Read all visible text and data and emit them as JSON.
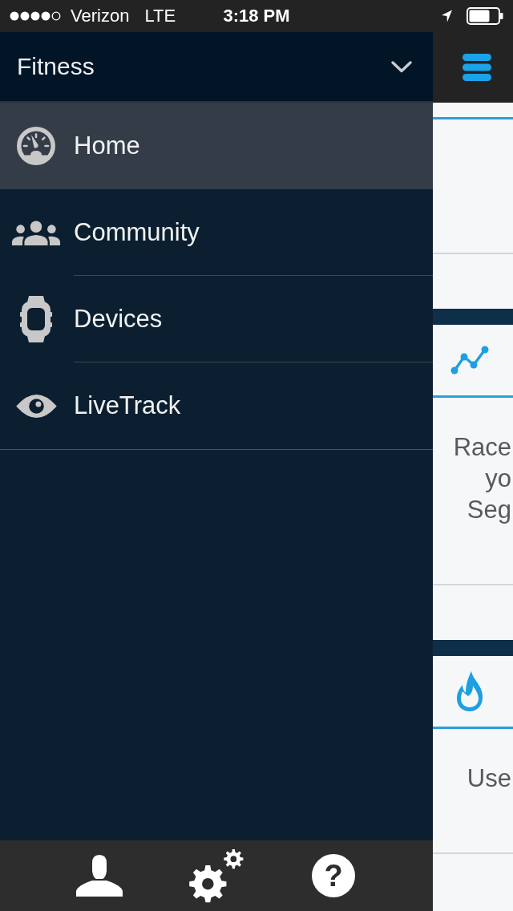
{
  "status_bar": {
    "carrier": "Verizon",
    "network": "LTE",
    "time": "3:18 PM"
  },
  "drawer": {
    "title": "Fitness",
    "expanded": false,
    "items": [
      {
        "label": "Home",
        "selected": true
      },
      {
        "label": "Community",
        "selected": false
      },
      {
        "label": "Devices",
        "selected": false
      },
      {
        "label": "LiveTrack",
        "selected": false
      }
    ],
    "toolbar": {
      "help": "?"
    }
  },
  "main": {
    "cards": [
      {
        "body_lines": [
          "Race",
          "yo",
          "Seg"
        ]
      },
      {
        "body_lines": [
          "Use"
        ]
      }
    ]
  }
}
